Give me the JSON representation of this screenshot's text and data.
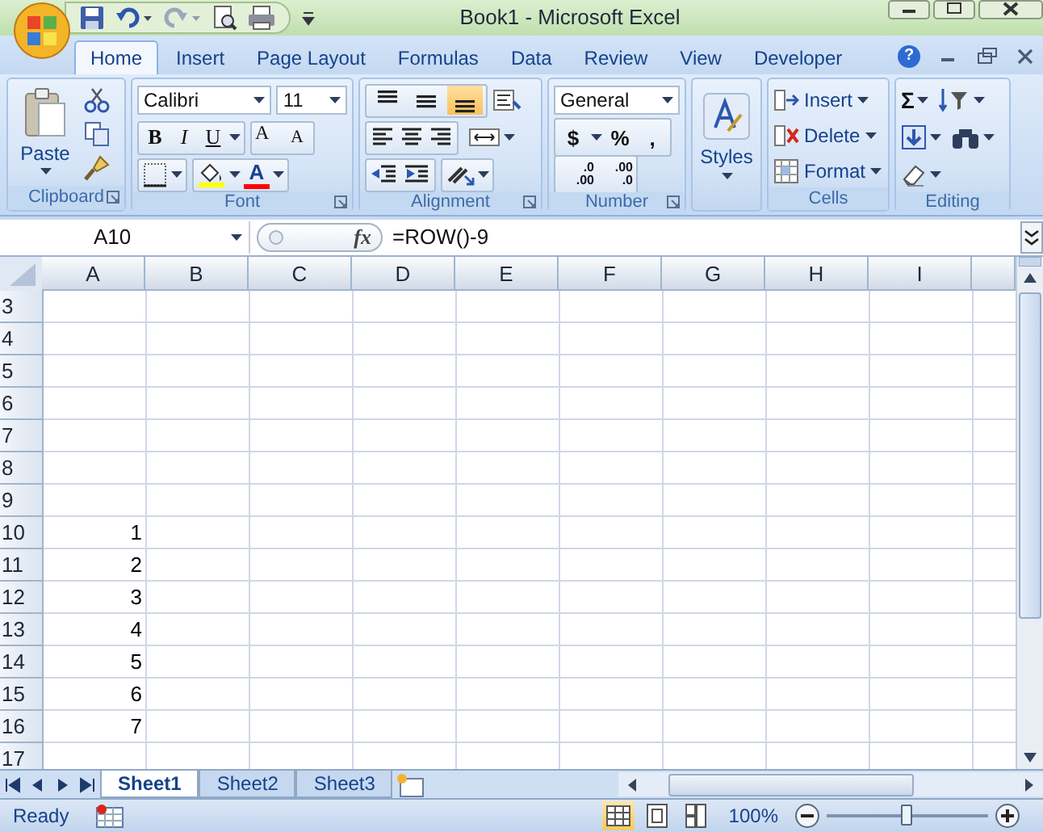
{
  "window": {
    "title": "Book1  -  Microsoft Excel"
  },
  "tabs": [
    {
      "label": "Home",
      "selected": true
    },
    {
      "label": "Insert",
      "selected": false
    },
    {
      "label": "Page Layout",
      "selected": false
    },
    {
      "label": "Formulas",
      "selected": false
    },
    {
      "label": "Data",
      "selected": false
    },
    {
      "label": "Review",
      "selected": false
    },
    {
      "label": "View",
      "selected": false
    },
    {
      "label": "Developer",
      "selected": false
    }
  ],
  "help_label": "?",
  "ribbon": {
    "clipboard": {
      "paste": "Paste",
      "label": "Clipboard"
    },
    "font": {
      "family": "Calibri",
      "size": "11",
      "style_buttons": [
        "B",
        "I",
        "U"
      ],
      "grow": "A",
      "shrink": "A",
      "color_letter": "A",
      "label": "Font"
    },
    "alignment": {
      "vertical_align": [
        {
          "selected": false
        },
        {
          "selected": false
        },
        {
          "selected": true
        }
      ],
      "label": "Alignment"
    },
    "number": {
      "format": "General",
      "symbols": [
        "$",
        "%",
        ","
      ],
      "decimals": [
        {
          "top": ".0",
          "bottom": ".00"
        },
        {
          "top": ".00",
          "bottom": ".0"
        }
      ],
      "label": "Number"
    },
    "styles": {
      "label": "Styles"
    },
    "cells": {
      "buttons": [
        "Insert",
        "Delete",
        "Format"
      ],
      "label": "Cells"
    },
    "editing": {
      "sum": "Σ",
      "label": "Editing"
    }
  },
  "formula_bar": {
    "name_box": "A10",
    "fx": "fx",
    "formula": "=ROW()-9"
  },
  "sheet": {
    "columns": [
      "A",
      "B",
      "C",
      "D",
      "E",
      "F",
      "G",
      "H",
      "I"
    ],
    "rows": [
      {
        "number": "3",
        "values": []
      },
      {
        "number": "4",
        "values": []
      },
      {
        "number": "5",
        "values": []
      },
      {
        "number": "6",
        "values": []
      },
      {
        "number": "7",
        "values": []
      },
      {
        "number": "8",
        "values": []
      },
      {
        "number": "9",
        "values": []
      },
      {
        "number": "10",
        "values": [
          "1"
        ]
      },
      {
        "number": "11",
        "values": [
          "2"
        ]
      },
      {
        "number": "12",
        "values": [
          "3"
        ]
      },
      {
        "number": "13",
        "values": [
          "4"
        ]
      },
      {
        "number": "14",
        "values": [
          "5"
        ]
      },
      {
        "number": "15",
        "values": [
          "6"
        ]
      },
      {
        "number": "16",
        "values": [
          "7"
        ]
      },
      {
        "number": "17",
        "values": []
      }
    ]
  },
  "sheets": [
    {
      "name": "Sheet1",
      "selected": true
    },
    {
      "name": "Sheet2",
      "selected": false
    },
    {
      "name": "Sheet3",
      "selected": false
    }
  ],
  "status": {
    "text": "Ready",
    "views": [
      {
        "selected": true
      },
      {
        "selected": false
      },
      {
        "selected": false
      }
    ],
    "zoom": "100%",
    "zoom_slider": {
      "level": 0.5
    }
  }
}
